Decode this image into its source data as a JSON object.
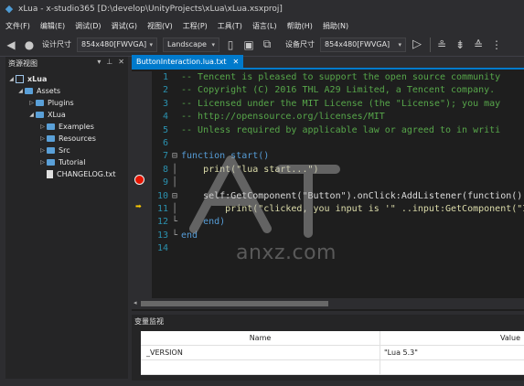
{
  "window": {
    "title": "xLua - x-studio365 [D:\\develop\\UnityProjects\\xLua\\xLua.xsxproj]"
  },
  "menu": [
    "文件(F)",
    "编辑(E)",
    "调试(D)",
    "调试(G)",
    "视图(V)",
    "工程(P)",
    "工具(T)",
    "语言(L)",
    "帮助(H)",
    "捐助(N)"
  ],
  "toolbar": {
    "design_size_label": "设计尺寸",
    "resolution_value": "854x480[FWVGA]",
    "orientation_value": "Landscape",
    "device_size_label": "设备尺寸",
    "device_resolution_value": "854x480[FWVGA]"
  },
  "resource_view": {
    "title": "资源视图",
    "project": "xLua",
    "items": [
      {
        "label": "Assets",
        "level": 1,
        "type": "folder",
        "expanded": true
      },
      {
        "label": "Plugins",
        "level": 2,
        "type": "folder",
        "expanded": false
      },
      {
        "label": "XLua",
        "level": 2,
        "type": "folder",
        "expanded": true
      },
      {
        "label": "Examples",
        "level": 3,
        "type": "folder",
        "expanded": false
      },
      {
        "label": "Resources",
        "level": 3,
        "type": "folder",
        "expanded": false
      },
      {
        "label": "Src",
        "level": 3,
        "type": "folder",
        "expanded": false
      },
      {
        "label": "Tutorial",
        "level": 3,
        "type": "folder",
        "expanded": false
      },
      {
        "label": "CHANGELOG.txt",
        "level": 3,
        "type": "file",
        "expanded": false
      }
    ]
  },
  "editor": {
    "tab_label": "ButtonInteraction.lua.txt",
    "lines": [
      {
        "n": "1",
        "text": "-- Tencent is pleased to support the open source community"
      },
      {
        "n": "2",
        "text": "-- Copyright (C) 2016 THL A29 Limited, a Tencent company."
      },
      {
        "n": "3",
        "text": "-- Licensed under the MIT License (the \"License\"); you may"
      },
      {
        "n": "4",
        "text": "-- http://opensource.org/licenses/MIT"
      },
      {
        "n": "5",
        "text": "-- Unless required by applicable law or agreed to in writi"
      },
      {
        "n": "6",
        "text": ""
      },
      {
        "n": "7",
        "text": "function start()"
      },
      {
        "n": "8",
        "text": "    print(\"lua start...\")"
      },
      {
        "n": "9",
        "text": ""
      },
      {
        "n": "10",
        "text": "    self:GetComponent(\"Button\").onClick:AddListener(function()"
      },
      {
        "n": "11",
        "text": "        print(\"clicked, you input is '\" ..input:GetComponent(\"In"
      },
      {
        "n": "12",
        "text": "    end)"
      },
      {
        "n": "13",
        "text": "end"
      },
      {
        "n": "14",
        "text": ""
      }
    ]
  },
  "watch": {
    "title": "变量监视",
    "col_name": "Name",
    "col_value": "Value",
    "rows": [
      {
        "name": "_VERSION",
        "value": "\"Lua 5.3\""
      }
    ]
  },
  "watermark_text": "anxz.com"
}
